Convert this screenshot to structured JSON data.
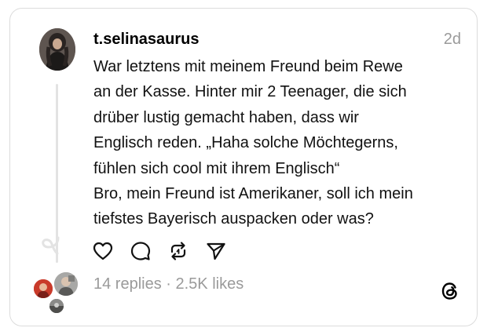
{
  "post": {
    "username": "t.selinasaurus",
    "time": "2d",
    "lines": [
      "War letztens mit meinem Freund beim Rewe",
      "an der Kasse. Hinter mir 2 Teenager, die sich",
      "drüber lustig gemacht haben, dass wir",
      "Englisch reden. „Haha solche Möchtegerns,",
      "fühlen sich cool mit ihrem Englisch“",
      "Bro, mein Freund ist Amerikaner, soll ich mein",
      "tiefstes Bayerisch auspacken oder was?"
    ]
  },
  "stats": {
    "replies": "14 replies",
    "separator": " · ",
    "likes": "2.5K likes"
  },
  "icons": {
    "like": "heart-icon",
    "reply": "comment-icon",
    "repost": "repost-icon",
    "share": "send-icon",
    "app": "threads-logo-icon"
  },
  "colors": {
    "text": "#111111",
    "muted": "#9a9a9a",
    "border": "#dcdcdc"
  }
}
